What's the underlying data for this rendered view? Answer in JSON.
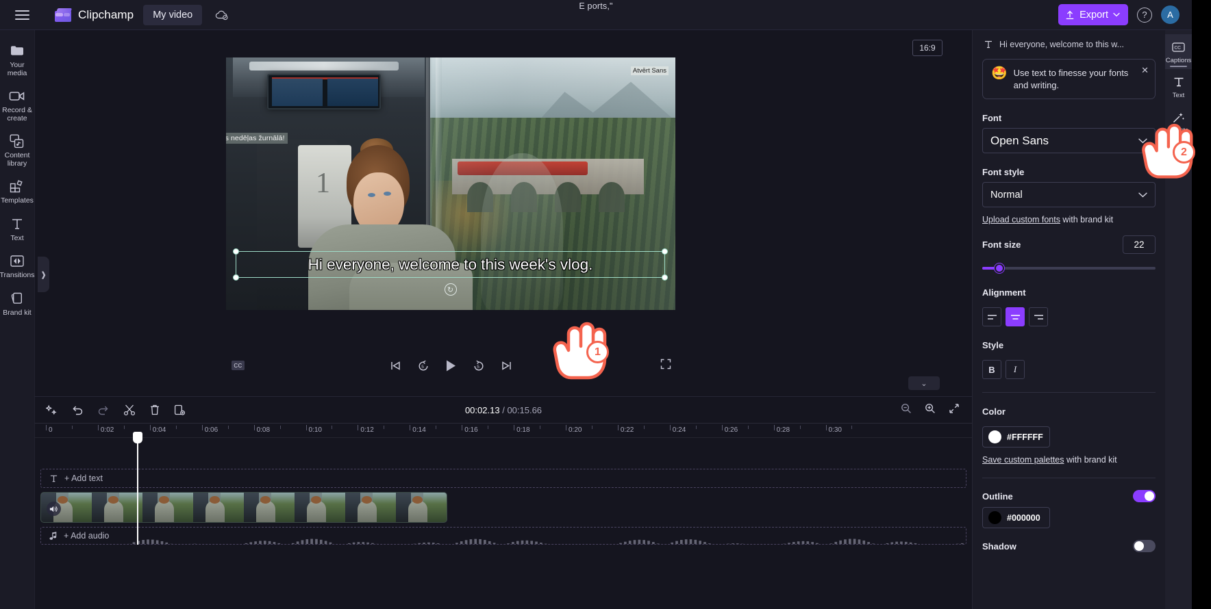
{
  "app": {
    "brand": "Clipchamp",
    "project_name": "My video",
    "window_title": "E ports,\"",
    "export_label": "Export",
    "help_label": "?",
    "avatar_initial": "A"
  },
  "left_rail": {
    "items": [
      {
        "label": "Your media",
        "icon": "media-folder-icon"
      },
      {
        "label": "Record & create",
        "icon": "camera-icon"
      },
      {
        "label": "Content library",
        "icon": "library-icon"
      },
      {
        "label": "Templates",
        "icon": "templates-icon"
      },
      {
        "label": "Text",
        "icon": "text-t-icon"
      },
      {
        "label": "Transitions",
        "icon": "transitions-icon"
      },
      {
        "label": "Brand kit",
        "icon": "brandkit-icon"
      }
    ]
  },
  "preview": {
    "aspect_ratio": "16:9",
    "overlay_font_label": "Atvērt Sans",
    "overlay_latvian_caption": "Labdien, sveicināts šīs nedēļas žurnālā!",
    "selected_caption": "Hi everyone, welcome to this week's vlog.",
    "cc_label": "CC",
    "controls": {
      "previous": "skip-previous",
      "back5": "back-5s",
      "play": "play",
      "forward5": "forward-5s",
      "next": "skip-next",
      "fullscreen": "fullscreen"
    }
  },
  "timeline": {
    "tools": [
      "magic-wand",
      "undo",
      "redo",
      "split-scissors",
      "delete-trash",
      "duplicate"
    ],
    "current_time": "00:02.13",
    "separator": "/",
    "total_time": "00:15.66",
    "zoom_out": "zoom-out",
    "zoom_in": "zoom-in",
    "fit": "fit-to-screen",
    "ruler_ticks": [
      "0",
      "0:02",
      "0:04",
      "0:06",
      "0:08",
      "0:10",
      "0:12",
      "0:14",
      "0:16",
      "0:18",
      "0:20",
      "0:22",
      "0:24",
      "0:26",
      "0:28",
      "0:30"
    ],
    "add_text_label": "+ Add text",
    "add_audio_label": "+ Add audio"
  },
  "right_panel": {
    "header_title": "Hi everyone, welcome to this w...",
    "tip": {
      "emoji": "🤩",
      "text": "Use text to finesse your fonts and writing."
    },
    "font_label": "Font",
    "font_value": "Open Sans",
    "font_style_label": "Font style",
    "font_style_value": "Normal",
    "upload_link": "Upload custom fonts",
    "upload_suffix": " with brand kit",
    "font_size_label": "Font size",
    "font_size_value": "22",
    "alignment_label": "Alignment",
    "alignment_options": [
      "left",
      "center",
      "right"
    ],
    "alignment_selected": "center",
    "style_label": "Style",
    "style_bold": "B",
    "style_italic": "I",
    "color_label": "Color",
    "color_value": "#FFFFFF",
    "save_palettes_link": "Save custom palettes",
    "save_palettes_suffix": " with brand kit",
    "outline_label": "Outline",
    "outline_enabled": "on",
    "outline_color": "#000000",
    "shadow_label": "Shadow",
    "shadow_enabled": "off"
  },
  "tab_rail": {
    "items": [
      {
        "label": "Captions",
        "icon": "cc-icon",
        "active": "true"
      },
      {
        "label": "Text",
        "icon": "text-t-icon",
        "active": "false"
      },
      {
        "label": "Effects",
        "icon": "effects-wand-icon",
        "active": "false"
      }
    ]
  },
  "callouts": {
    "step1": "1",
    "step2": "2"
  },
  "colors": {
    "accent": "#8b3dff",
    "panel": "#1b1b26",
    "background": "#15151f",
    "callout": "#f4634e"
  }
}
